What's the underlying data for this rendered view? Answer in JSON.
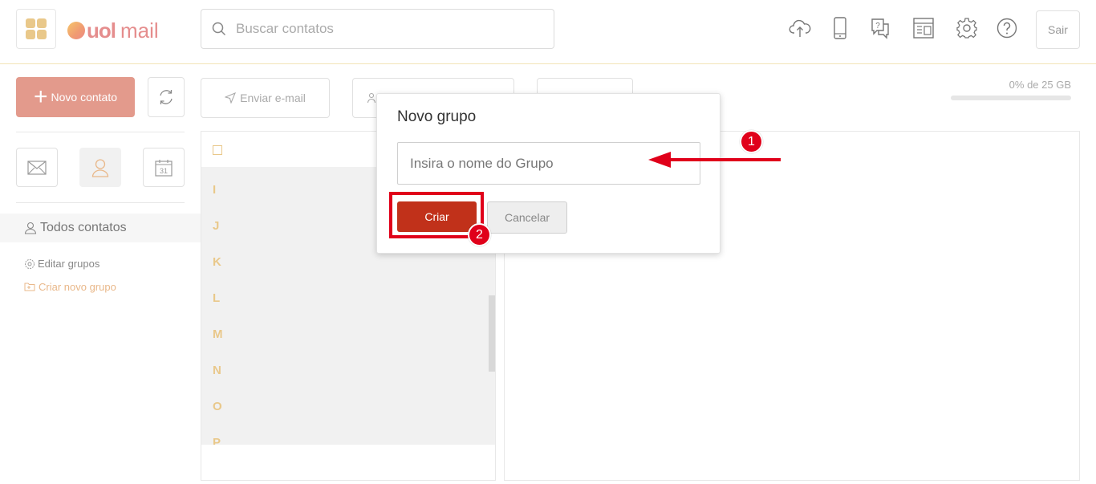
{
  "header": {
    "logo_uol": "uol",
    "logo_mail": "mail",
    "search_placeholder": "Buscar contatos",
    "icons": [
      "cloud-upload-icon",
      "mobile-icon",
      "help-chat-icon",
      "newsletter-icon",
      "gear-icon",
      "help-icon"
    ],
    "sair_label": "Sair"
  },
  "toolbar": {
    "novo_contato_label": "Novo contato",
    "enviar_email_label": "Enviar e-mail",
    "quota_label": "0% de 25 GB",
    "quota_percent": 0
  },
  "sidebar": {
    "todos_contatos_label": "Todos contatos",
    "editar_grupos_label": "Editar grupos",
    "criar_novo_grupo_label": "Criar novo grupo"
  },
  "contacts": {
    "letters": [
      "I",
      "J",
      "K",
      "L",
      "M",
      "N",
      "O",
      "P"
    ]
  },
  "modal": {
    "title": "Novo grupo",
    "input_placeholder": "Insira o nome do Grupo",
    "input_value": "",
    "criar_label": "Criar",
    "cancelar_label": "Cancelar"
  },
  "annotations": {
    "step_1": "1",
    "step_2": "2",
    "color": "#e0001a"
  },
  "colors": {
    "accent": "#e39a8c",
    "brand": "#e58d8d",
    "primary_button": "#c1311a",
    "letter": "#e9c88a"
  }
}
